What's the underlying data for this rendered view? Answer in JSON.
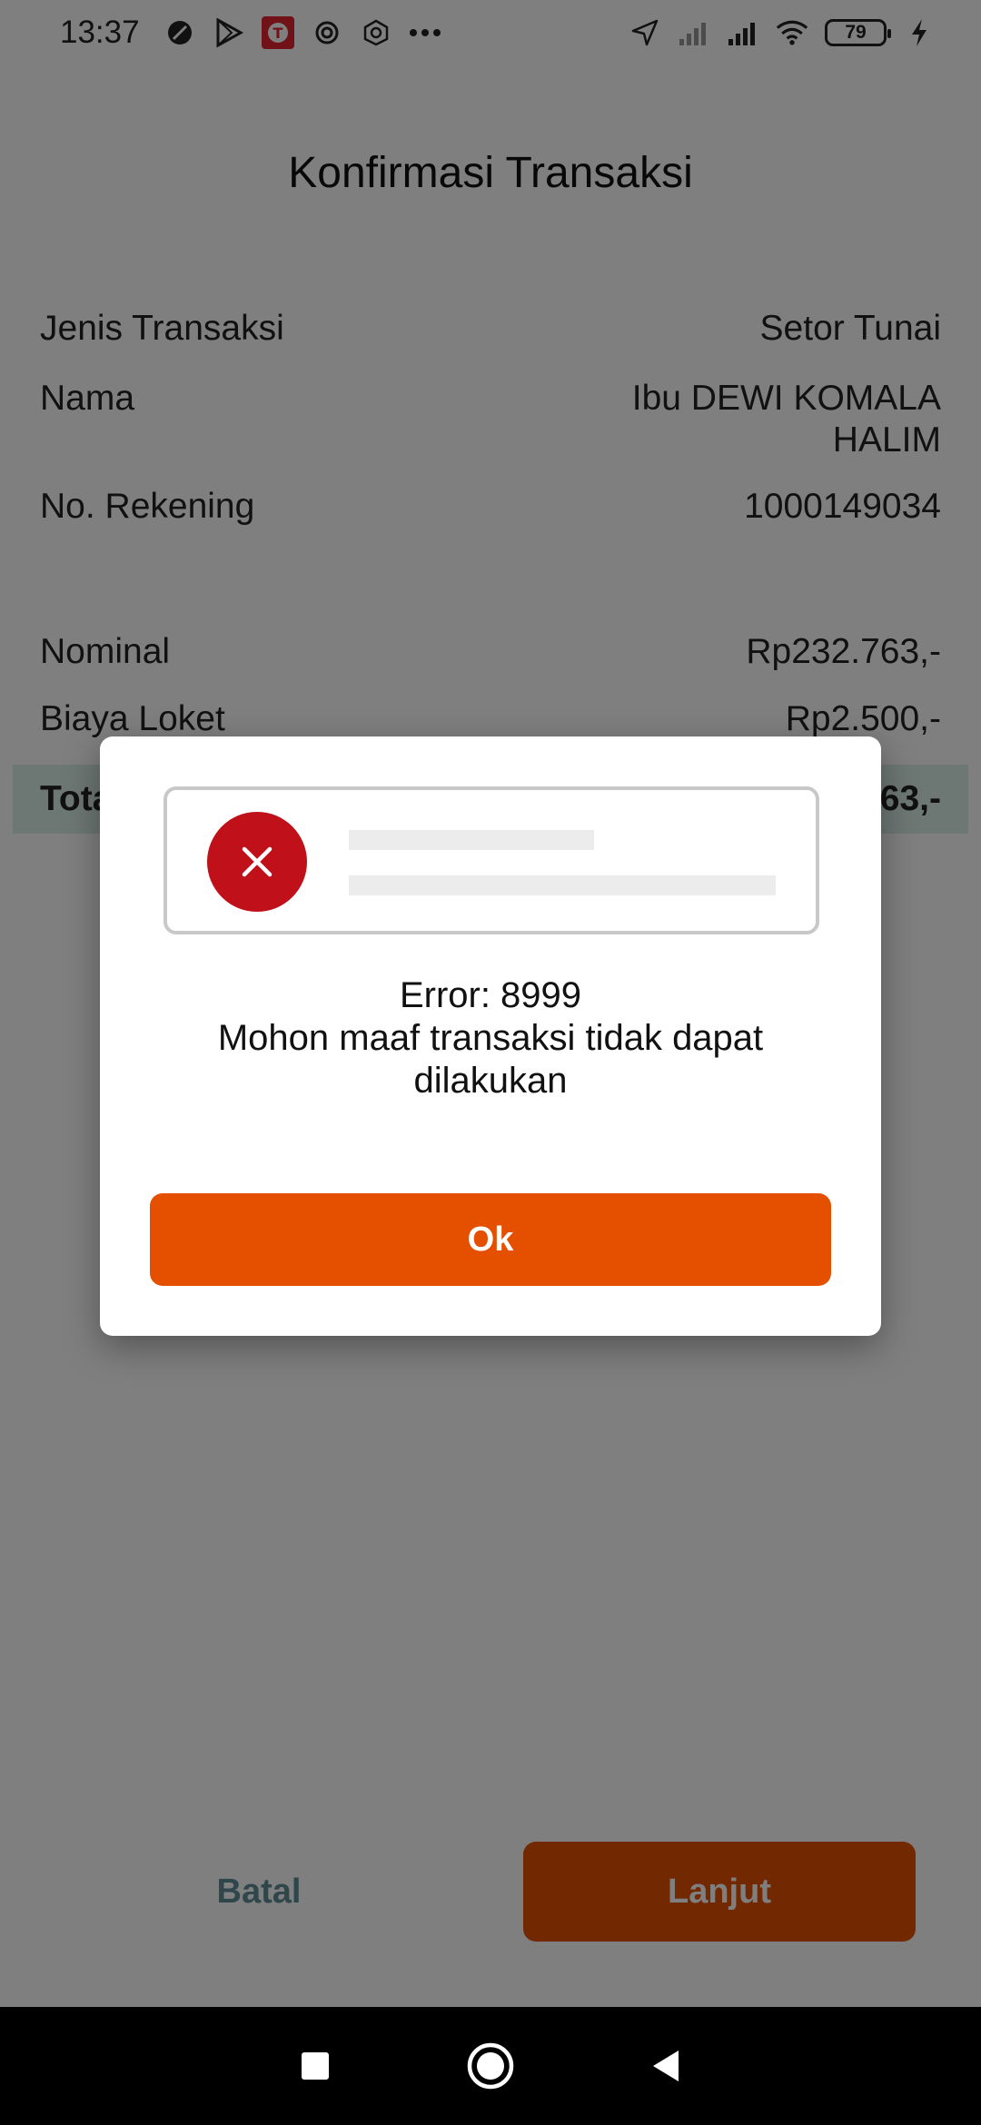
{
  "status_bar": {
    "time": "13:37",
    "battery": "79",
    "icons": [
      "do-not-disturb-icon",
      "play-store-icon",
      "telkomsel-app-icon",
      "settings-gear-icon",
      "settings-hex-icon",
      "more-dots-icon",
      "location-arrow-icon",
      "signal-weak-icon",
      "signal-icon",
      "wifi-icon",
      "battery-icon",
      "charging-bolt-icon"
    ]
  },
  "header": {
    "title": "Konfirmasi Transaksi"
  },
  "details": [
    {
      "label": "Jenis Transaksi",
      "value": "Setor Tunai"
    },
    {
      "label": "Nama",
      "value_line1": "Ibu DEWI KOMALA",
      "value_line2": "HALIM"
    },
    {
      "label": "No. Rekening",
      "value": "1000149034"
    }
  ],
  "amounts": [
    {
      "label": "Nominal",
      "value": "Rp232.763,-"
    },
    {
      "label": "Biaya Loket",
      "value": "Rp2.500,-"
    },
    {
      "label": "Tota",
      "value": "63,-"
    }
  ],
  "actions": {
    "cancel_label": "Batal",
    "continue_label": "Lanjut"
  },
  "dialog": {
    "error_code": "Error: 8999",
    "message_line1": "Mohon maaf transaksi tidak dapat",
    "message_line2": "dilakukan",
    "ok_label": "Ok",
    "error_icon": "close-x-icon"
  },
  "colors": {
    "accent": "#e45000",
    "error": "#c0111a",
    "batal_text": "#5e8c96",
    "total_bg": "#dbeee8"
  }
}
